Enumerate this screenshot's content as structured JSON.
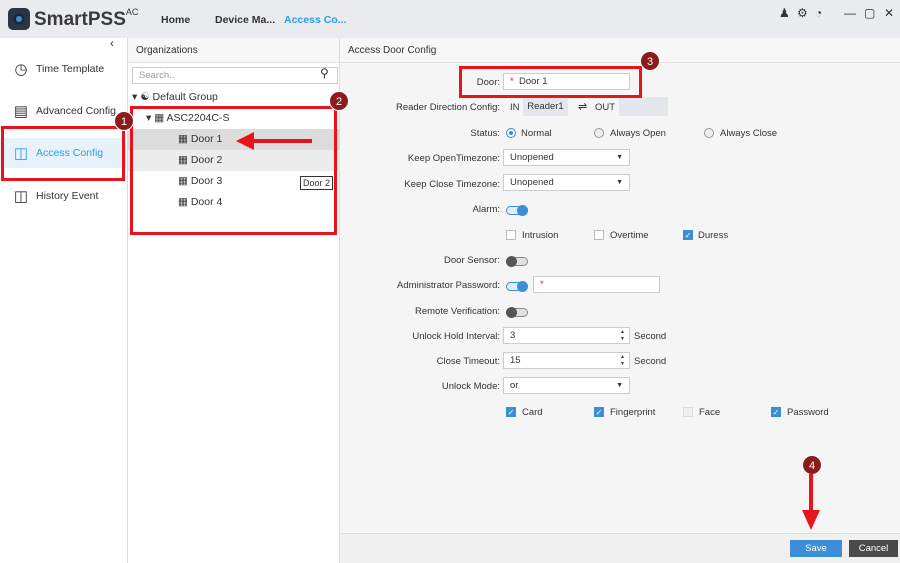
{
  "app": {
    "brand": "SmartPSS",
    "brand_sup": "AC",
    "tabs": [
      "Home",
      "Device Ma...",
      "Access Co..."
    ],
    "active_tab": 2
  },
  "window_icons": [
    "user-icon",
    "gear-icon",
    "speedometer-icon",
    "minimize-icon",
    "maximize-icon",
    "close-icon"
  ],
  "sidebar": {
    "items": [
      {
        "label": "Time Template",
        "icon": "clock-icon"
      },
      {
        "label": "Advanced Config",
        "icon": "briefcase-icon"
      },
      {
        "label": "Access Config",
        "icon": "door-icon",
        "active": true
      },
      {
        "label": "History Event",
        "icon": "door-history-icon"
      }
    ]
  },
  "org": {
    "title": "Organizations",
    "search_placeholder": "Search..",
    "group": "Default Group",
    "device": "ASC2204C-S",
    "doors": [
      "Door 1",
      "Door 2",
      "Door 3",
      "Door 4"
    ],
    "tooltip": "Door 2"
  },
  "config": {
    "title": "Access Door Config",
    "door_label": "Door:",
    "door_value": "Door 1",
    "reader_label": "Reader Direction Config:",
    "reader_in": "IN",
    "reader_value": "Reader1",
    "reader_out": "OUT",
    "status_label": "Status:",
    "status_options": [
      "Normal",
      "Always Open",
      "Always Close"
    ],
    "status_selected": "Normal",
    "keep_open_label": "Keep OpenTimezone:",
    "keep_open_value": "Unopened",
    "keep_close_label": "Keep Close Timezone:",
    "keep_close_value": "Unopened",
    "alarm_label": "Alarm:",
    "alarm_on": true,
    "alarm_options": [
      {
        "label": "Intrusion",
        "checked": false
      },
      {
        "label": "Overtime",
        "checked": false
      },
      {
        "label": "Duress",
        "checked": true
      }
    ],
    "door_sensor_label": "Door Sensor:",
    "door_sensor_on": false,
    "admin_pw_label": "Administrator Password:",
    "admin_pw_on": true,
    "remote_label": "Remote Verification:",
    "remote_on": false,
    "unlock_hold_label": "Unlock Hold Interval:",
    "unlock_hold_value": "3",
    "unlock_hold_unit": "Second",
    "close_timeout_label": "Close Timeout:",
    "close_timeout_value": "15",
    "close_timeout_unit": "Second",
    "unlock_mode_label": "Unlock Mode:",
    "unlock_mode_value": "or",
    "unlock_methods": [
      {
        "label": "Card",
        "checked": true
      },
      {
        "label": "Fingerprint",
        "checked": true
      },
      {
        "label": "Face",
        "checked": false,
        "disabled": true
      },
      {
        "label": "Password",
        "checked": true
      }
    ]
  },
  "footer": {
    "save": "Save",
    "cancel": "Cancel",
    "save_color": "#3b8fd6",
    "cancel_color": "#4a4a4a"
  },
  "annotations": {
    "badges": [
      "1",
      "2",
      "3",
      "4"
    ],
    "color": "#e8141b"
  }
}
